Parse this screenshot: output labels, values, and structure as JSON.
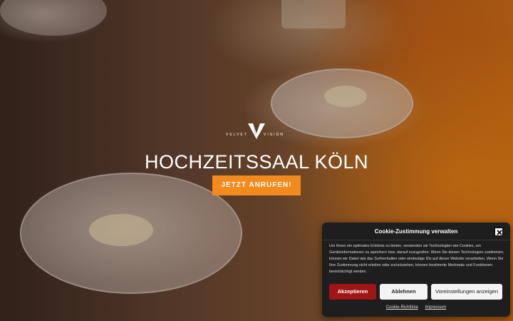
{
  "logo": {
    "left_text": "VELVET",
    "right_text": "VISION"
  },
  "hero": {
    "title": "HOCHZEITSSAAL KÖLN",
    "cta_label": "JETZT ANRUFEN!"
  },
  "cookie": {
    "title": "Cookie-Zustimmung verwalten",
    "text": "Um Ihnen ein optimales Erlebnis zu bieten, verwenden wir Technologien wie Cookies, um Geräteinformationen zu speichern bzw. darauf zuzugreifen. Wenn Sie diesen Technologien zustimmen, können wir Daten wie das Surfverhalten oder eindeutige IDs auf dieser Website verarbeiten. Wenn Sie Ihre Zustimmung nicht erteilen oder zurückziehen, können bestimmte Merkmale und Funktionen beeinträchtigt werden.",
    "accept_label": "Akzeptieren",
    "reject_label": "Ablehnen",
    "preferences_label": "Voreinstellungen anzeigen",
    "links": [
      "Cookie-Richtlinie",
      "Impressum"
    ]
  },
  "colors": {
    "accent": "#f28a1e",
    "accept_button": "#a01515",
    "dialog_bg": "#1e1e1e"
  },
  "icons": {
    "logo": "velvet-vision-v-logo",
    "close": "close-icon"
  }
}
